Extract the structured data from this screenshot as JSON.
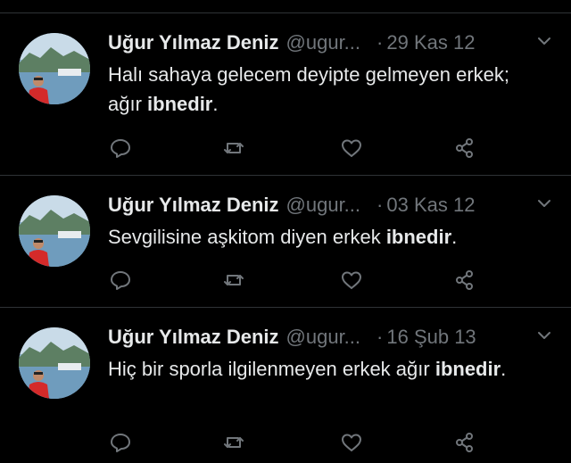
{
  "colors": {
    "background": "#000000",
    "divider": "#2f3336",
    "text_primary": "#e7e9ea",
    "text_secondary": "#71767b"
  },
  "tweets": [
    {
      "author": {
        "name": "Uğur Yılmaz Deniz",
        "handle": "@ugur...",
        "avatar_icon": "avatar-photo"
      },
      "separator": "·",
      "date": "29 Kas 12",
      "text_before": "Halı sahaya gelecem deyipte gelmeyen erkek; ağır ",
      "text_bold": "ibnedir",
      "text_after": ".",
      "actions": [
        "reply-icon",
        "retweet-icon",
        "like-icon",
        "share-icon"
      ]
    },
    {
      "author": {
        "name": "Uğur Yılmaz Deniz",
        "handle": "@ugur...",
        "avatar_icon": "avatar-photo"
      },
      "separator": "·",
      "date": "03 Kas 12",
      "text_before": "Sevgilisine aşkitom diyen erkek ",
      "text_bold": "ibnedir",
      "text_after": ".",
      "actions": [
        "reply-icon",
        "retweet-icon",
        "like-icon",
        "share-icon"
      ]
    },
    {
      "author": {
        "name": "Uğur Yılmaz Deniz",
        "handle": "@ugur...",
        "avatar_icon": "avatar-photo"
      },
      "separator": "·",
      "date": "16 Şub 13",
      "text_before": "Hiç bir sporla ilgilenmeyen erkek ağır ",
      "text_bold": "ibnedir",
      "text_after": ".",
      "actions": [
        "reply-icon",
        "retweet-icon",
        "like-icon",
        "share-icon"
      ]
    }
  ]
}
